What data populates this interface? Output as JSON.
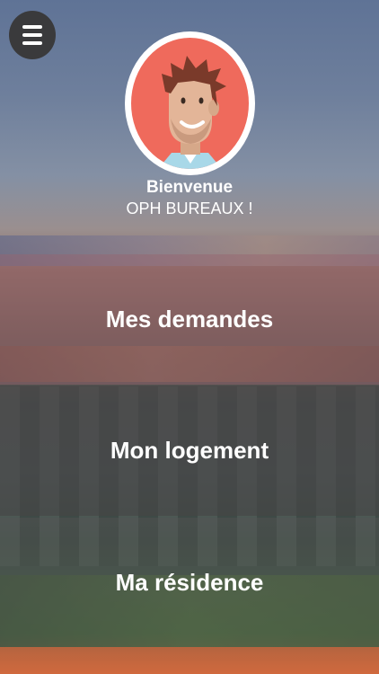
{
  "header": {
    "menu_icon": "hamburger-icon",
    "avatar_icon": "cartoon-man-avatar"
  },
  "welcome": {
    "greeting": "Bienvenue",
    "name": "OPH BUREAUX !"
  },
  "nav": {
    "items": [
      {
        "label": "Mes demandes"
      },
      {
        "label": "Mon logement"
      },
      {
        "label": "Ma résidence"
      }
    ]
  },
  "colors": {
    "avatar_bg": "#ef6a5c",
    "avatar_ring": "#ffffff",
    "menu_button_bg": "#3a3a3c",
    "bottom_accent": "#d0693e"
  }
}
